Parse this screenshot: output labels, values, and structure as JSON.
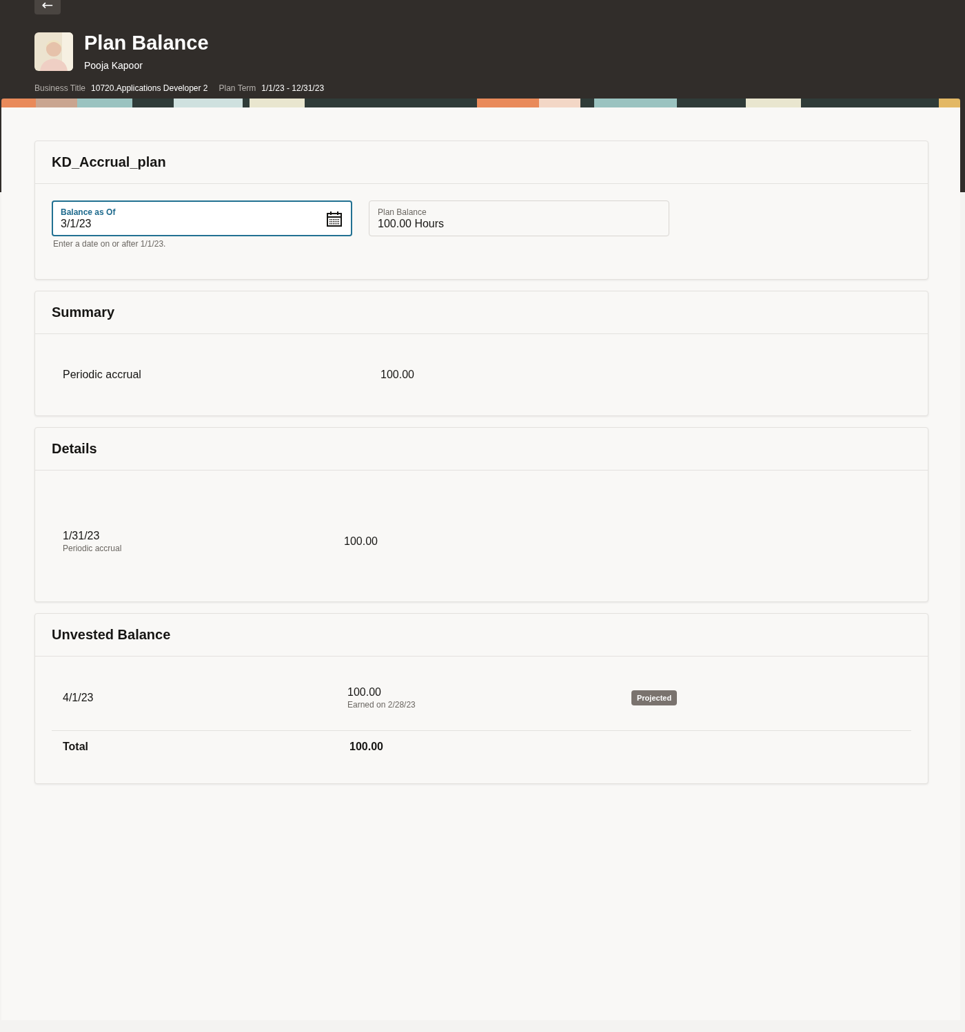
{
  "header": {
    "back": "←",
    "title": "Plan Balance",
    "person": "Pooja Kapoor",
    "facts": [
      {
        "label": "Business Title",
        "value": "10720.Applications Developer 2"
      },
      {
        "label": "Plan Term",
        "value": "1/1/23 - 12/31/23"
      }
    ]
  },
  "plan": {
    "title": "KD_Accrual_plan",
    "date_field": {
      "label": "Balance as Of",
      "value": "3/1/23",
      "hint": "Enter a date on or after 1/1/23.",
      "focused": true
    },
    "balance_field": {
      "label": "Plan Balance",
      "value": "100.00 Hours"
    }
  },
  "summary": {
    "title": "Summary",
    "rows": [
      {
        "label": "Periodic accrual",
        "value": "100.00"
      }
    ]
  },
  "details": {
    "title": "Details",
    "rows": [
      {
        "date": "1/31/23",
        "type": "Periodic accrual",
        "value": "100.00"
      }
    ]
  },
  "unvested": {
    "title": "Unvested Balance",
    "rows": [
      {
        "date": "4/1/23",
        "value": "100.00",
        "note": "Earned on 2/28/23",
        "badge": "Projected"
      }
    ],
    "total": {
      "label": "Total",
      "value": "100.00"
    }
  }
}
